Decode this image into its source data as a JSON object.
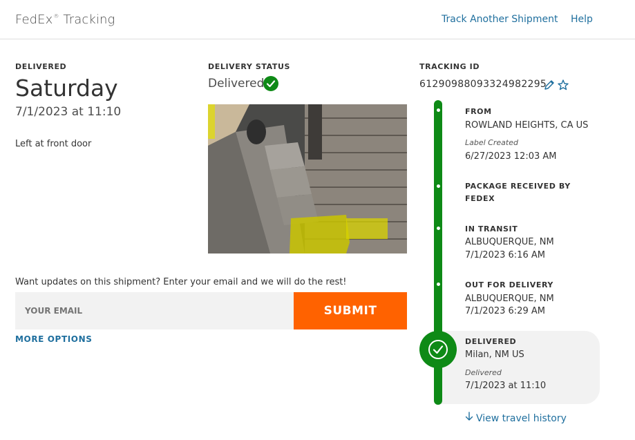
{
  "header": {
    "brand": "FedEx",
    "brand_mark": "®",
    "brand_suffix": "Tracking",
    "nav": {
      "track_another": "Track Another Shipment",
      "help": "Help"
    }
  },
  "delivered": {
    "label": "DELIVERED",
    "day": "Saturday",
    "datetime": "7/1/2023 at 11:10",
    "location_note": "Left at front door"
  },
  "status": {
    "label": "DELIVERY STATUS",
    "value": "Delivered",
    "color": "#0e8a16"
  },
  "updates": {
    "prompt": "Want updates on this shipment? Enter your email and we will do the rest!",
    "email_placeholder": "YOUR EMAIL",
    "submit_label": "SUBMIT",
    "more_options": "MORE OPTIONS",
    "accent": "#ff6200"
  },
  "tracking": {
    "label": "TRACKING ID",
    "number": "612909880933249822 95",
    "number_display": "61290988093324982295",
    "edit_icon": "pencil-icon",
    "favorite_icon": "star-icon"
  },
  "timeline": {
    "events": [
      {
        "title": "FROM",
        "place": "ROWLAND HEIGHTS, CA US",
        "note": "Label Created",
        "time": "6/27/2023 12:03 AM"
      },
      {
        "title_line1": "PACKAGE RECEIVED BY",
        "title_line2": "FEDEX"
      },
      {
        "title": "IN TRANSIT",
        "place": "ALBUQUERQUE, NM",
        "time": "7/1/2023 6:16 AM"
      },
      {
        "title": "OUT FOR DELIVERY",
        "place": "ALBUQUERQUE, NM",
        "time": "7/1/2023 6:29 AM"
      },
      {
        "title": "DELIVERED",
        "place": "Milan, NM US",
        "note": "Delivered",
        "time": "7/1/2023 at 11:10"
      }
    ],
    "view_history": "View travel history"
  }
}
